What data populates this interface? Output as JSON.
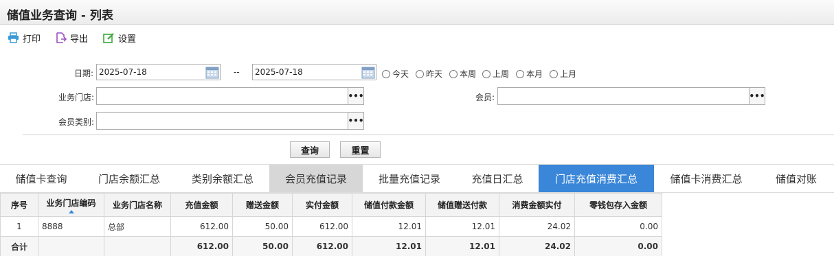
{
  "page": {
    "title": "储值业务查询 - 列表"
  },
  "toolbar": {
    "print_label": "打印",
    "export_label": "导出",
    "settings_label": "设置"
  },
  "filters": {
    "date_label": "日期:",
    "date_from": "2025-07-18",
    "date_sep": "--",
    "date_to": "2025-07-18",
    "quick_ranges": [
      "今天",
      "昨天",
      "本周",
      "上周",
      "本月",
      "上月"
    ],
    "store_label": "业务门店:",
    "store_value": "",
    "member_label": "会员:",
    "member_value": "",
    "member_type_label": "会员类别:",
    "member_type_value": "",
    "more_glyph": "•••"
  },
  "actions": {
    "query_label": "查询",
    "reset_label": "重置"
  },
  "tabs": [
    {
      "label": "储值卡查询",
      "state": "normal"
    },
    {
      "label": "门店余额汇总",
      "state": "normal"
    },
    {
      "label": "类别余额汇总",
      "state": "normal"
    },
    {
      "label": "会员充值记录",
      "state": "gray"
    },
    {
      "label": "批量充值记录",
      "state": "normal"
    },
    {
      "label": "充值日汇总",
      "state": "normal"
    },
    {
      "label": "门店充值消费汇总",
      "state": "active"
    },
    {
      "label": "储值卡消费汇总",
      "state": "normal"
    },
    {
      "label": "储值对账",
      "state": "normal"
    }
  ],
  "table": {
    "headers": [
      "序号",
      "业务门店编码",
      "业务门店名称",
      "充值金额",
      "赠送金额",
      "实付金额",
      "储值付款金额",
      "储值赠送付款",
      "消费金额实付",
      "零钱包存入金额"
    ],
    "rows": [
      [
        "1",
        "8888",
        "总部",
        "612.00",
        "50.00",
        "612.00",
        "12.01",
        "12.01",
        "24.02",
        "0.00"
      ]
    ],
    "total": [
      "合计",
      "",
      "",
      "612.00",
      "50.00",
      "612.00",
      "12.01",
      "12.01",
      "24.02",
      "0.00"
    ]
  },
  "colors": {
    "accent": "#3a86d8",
    "tab_gray": "#d7d7d7",
    "print_icon": "#3a9ad6",
    "export_icon": "#9b4fc4",
    "settings_icon": "#3aa63a"
  },
  "icons": {
    "print": "printer-icon",
    "export": "export-icon",
    "settings": "edit-icon",
    "calendar": "calendar-icon"
  }
}
